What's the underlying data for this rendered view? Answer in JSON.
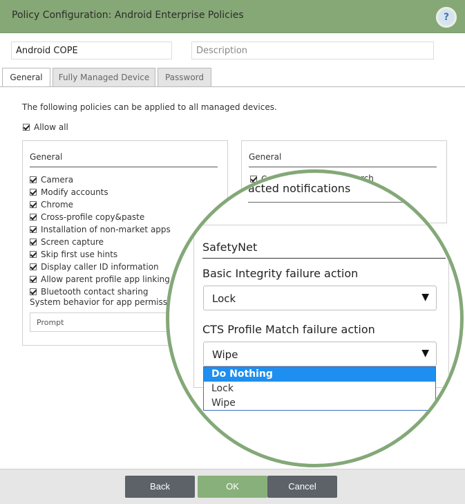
{
  "window": {
    "title": "Policy Configuration: Android Enterprise Policies",
    "help_label": "?"
  },
  "form": {
    "name_value": "Android COPE",
    "description_placeholder": "Description"
  },
  "tabs": [
    {
      "label": "General",
      "active": true
    },
    {
      "label": "Fully Managed Device",
      "active": false
    },
    {
      "label": "Password",
      "active": false
    }
  ],
  "content": {
    "intro": "The following policies can be applied to all managed devices.",
    "allow_all": {
      "label": "Allow all",
      "checked": true
    }
  },
  "left_panel": {
    "title": "General",
    "items": [
      {
        "label": "Camera",
        "checked": true
      },
      {
        "label": "Modify accounts",
        "checked": true
      },
      {
        "label": "Chrome",
        "checked": true
      },
      {
        "label": "Cross-profile copy&paste",
        "checked": true
      },
      {
        "label": "Installation of non-market apps",
        "checked": true
      },
      {
        "label": "Screen capture",
        "checked": true
      },
      {
        "label": "Skip first use hints",
        "checked": true
      },
      {
        "label": "Display caller ID information",
        "checked": true
      },
      {
        "label": "Allow parent profile app linking",
        "checked": true
      },
      {
        "label": "Bluetooth contact sharing",
        "checked": true
      }
    ],
    "system_behavior_label": "System behavior for app permissio",
    "system_behavior_value": "Prompt"
  },
  "right_panel": {
    "title": "General",
    "first_item_fragment_left": "C",
    "first_item_fragment_right": "rch"
  },
  "zoom": {
    "fragment_text": "acted notifications",
    "section_title": "SafetyNet",
    "basic_integrity": {
      "label": "Basic Integrity failure action",
      "value": "Lock"
    },
    "cts_profile": {
      "label": "CTS Profile Match failure action",
      "value": "Wipe"
    },
    "dropdown_arrow": "▼",
    "dropdown_options": [
      {
        "label": "Do Nothing",
        "highlighted": true
      },
      {
        "label": "Lock",
        "highlighted": false
      },
      {
        "label": "Wipe",
        "highlighted": false
      }
    ]
  },
  "footer": {
    "back_label": "Back",
    "ok_label": "OK",
    "cancel_label": "Cancel"
  },
  "colors": {
    "titlebar": "#86a876",
    "ok_button": "#88b07a",
    "secondary_button": "#5c6268",
    "lens_border": "#84a878",
    "highlight": "#1e8ff0"
  }
}
